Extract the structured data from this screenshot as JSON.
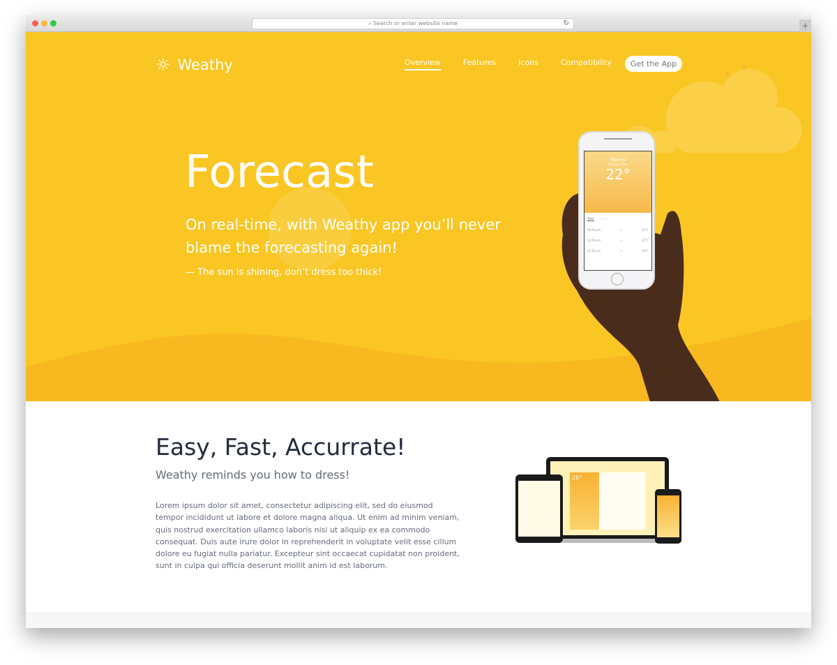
{
  "browser": {
    "url_placeholder": "Search or enter website name",
    "colors": {
      "close": "#fc605c",
      "min": "#fdbc40",
      "max": "#34c84a"
    }
  },
  "brand": {
    "name": "Weathy",
    "accent": "#F9C623"
  },
  "nav": {
    "items": [
      "Overview",
      "Features",
      "Icons",
      "Compatibility"
    ],
    "active": "Overview",
    "cta": "Get the App"
  },
  "hero": {
    "title": "Forecast",
    "subtitle": "On real-time, with Weathy app you’ll never blame the forecasting again!",
    "quote": "— The sun is shining, don’t dress too thick!"
  },
  "phone": {
    "condition": "Sunny",
    "location": "Beijing, China",
    "temp": "22°",
    "tabs": [
      "Time",
      "Daily"
    ],
    "rows": [
      {
        "time": "09:00 pm",
        "temp": "22°C"
      },
      {
        "time": "10:00 pm",
        "temp": "21°C"
      },
      {
        "time": "11:00 pm",
        "temp": "20°C"
      }
    ]
  },
  "devices": {
    "temp": "26°"
  },
  "section": {
    "title": "Easy, Fast, Accurrate!",
    "subtitle": "Weathy reminds you how to dress!",
    "body": "Lorem ipsum dolor sit amet, consectetur adipiscing elit, sed do eiusmod tempor incididunt ut labore et dolore magna aliqua. Ut enim ad minim veniam, quis nostrud exercitation ullamco laboris nisi ut aliquip ex ea commodo consequat. Duis aute irure dolor in reprehenderit in voluptate velit esse cillum dolore eu fugiat nulla pariatur. Excepteur sint occaecat cupidatat non proident, sunt in culpa qui officia deserunt mollit anim id est laborum."
  }
}
